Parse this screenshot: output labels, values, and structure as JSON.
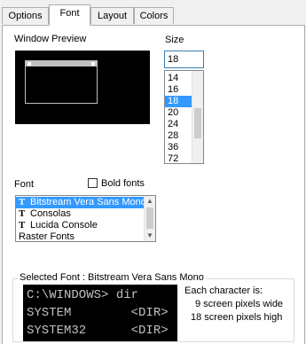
{
  "tabs": [
    {
      "label": "Options"
    },
    {
      "label": "Font"
    },
    {
      "label": "Layout"
    },
    {
      "label": "Colors"
    }
  ],
  "window_preview": {
    "label": "Window Preview"
  },
  "size": {
    "label": "Size",
    "value": "18",
    "options": [
      "14",
      "16",
      "18",
      "20",
      "24",
      "28",
      "36",
      "72"
    ],
    "selected": "18"
  },
  "font": {
    "label": "Font",
    "bold_label": "Bold fonts",
    "bold_checked": false,
    "items": [
      {
        "label": "Bitstream Vera Sans Mono",
        "icon": "truetype-icon",
        "selected": true
      },
      {
        "label": "Consolas",
        "icon": "truetype-icon",
        "selected": false
      },
      {
        "label": "Lucida Console",
        "icon": "truetype-icon",
        "selected": false
      },
      {
        "label": "Raster Fonts",
        "icon": "",
        "selected": false
      }
    ]
  },
  "selected_font": {
    "label": "Selected Font : Bitstream Vera Sans Mono",
    "sample_lines": [
      "C:\\WINDOWS> dir",
      "SYSTEM        <DIR>",
      "SYSTEM32      <DIR>"
    ],
    "each_char_label": "Each character is:",
    "width_text": "9 screen pixels wide",
    "height_text": "18 screen pixels high"
  },
  "colors": {
    "selection": "#3399ff",
    "console_bg": "#000000",
    "console_fg": "#c0c0c0",
    "focus_border": "#3c7fb1"
  }
}
